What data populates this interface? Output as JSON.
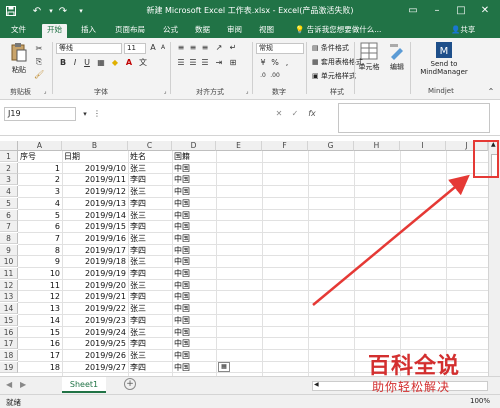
{
  "title": {
    "text": "新建 Microsoft Excel 工作表.xlsx - Excel(产品激活失败)"
  },
  "menu": {
    "file": "文件",
    "home": "开始",
    "insert": "插入",
    "layout": "页面布局",
    "formulas": "公式",
    "data": "数据",
    "review": "审阅",
    "view": "视图",
    "tell_me": "告诉我您想要做什么...",
    "share": "共享"
  },
  "ribbon": {
    "paste": "粘贴",
    "font_name": "等线",
    "font_size": "11",
    "number_format": "常规",
    "conditional_format": "条件格式",
    "table_format": "套用表格格式",
    "cell_style": "单元格样式",
    "cells": "单元格",
    "editing": "编辑",
    "send_to_line1": "Send to",
    "send_to_line2": "MindManager",
    "group_clipboard": "剪贴板",
    "group_font": "字体",
    "group_alignment": "对齐方式",
    "group_number": "数字",
    "group_styles": "样式",
    "group_mindjet": "Mindjet"
  },
  "formula_bar": {
    "name_box": "J19",
    "fx": "fx"
  },
  "grid": {
    "columns": [
      "A",
      "B",
      "C",
      "D",
      "E",
      "F",
      "G",
      "H",
      "I",
      "J"
    ],
    "row_numbers": [
      "1",
      "2",
      "3",
      "4",
      "5",
      "6",
      "7",
      "8",
      "9",
      "10",
      "11",
      "12",
      "13",
      "14",
      "15",
      "16",
      "17",
      "18",
      "19"
    ],
    "header": {
      "a": "序号",
      "b": "日期",
      "c": "姓名",
      "d": "国籍"
    },
    "rows": [
      {
        "a": "1",
        "b": "2019/9/10",
        "c": "张三",
        "d": "中国"
      },
      {
        "a": "2",
        "b": "2019/9/11",
        "c": "李四",
        "d": "中国"
      },
      {
        "a": "3",
        "b": "2019/9/12",
        "c": "张三",
        "d": "中国"
      },
      {
        "a": "4",
        "b": "2019/9/13",
        "c": "李四",
        "d": "中国"
      },
      {
        "a": "5",
        "b": "2019/9/14",
        "c": "张三",
        "d": "中国"
      },
      {
        "a": "6",
        "b": "2019/9/15",
        "c": "李四",
        "d": "中国"
      },
      {
        "a": "7",
        "b": "2019/9/16",
        "c": "张三",
        "d": "中国"
      },
      {
        "a": "8",
        "b": "2019/9/17",
        "c": "李四",
        "d": "中国"
      },
      {
        "a": "9",
        "b": "2019/9/18",
        "c": "张三",
        "d": "中国"
      },
      {
        "a": "10",
        "b": "2019/9/19",
        "c": "李四",
        "d": "中国"
      },
      {
        "a": "11",
        "b": "2019/9/20",
        "c": "张三",
        "d": "中国"
      },
      {
        "a": "12",
        "b": "2019/9/21",
        "c": "李四",
        "d": "中国"
      },
      {
        "a": "13",
        "b": "2019/9/22",
        "c": "张三",
        "d": "中国"
      },
      {
        "a": "14",
        "b": "2019/9/23",
        "c": "李四",
        "d": "中国"
      },
      {
        "a": "15",
        "b": "2019/9/24",
        "c": "张三",
        "d": "中国"
      },
      {
        "a": "16",
        "b": "2019/9/25",
        "c": "李四",
        "d": "中国"
      },
      {
        "a": "17",
        "b": "2019/9/26",
        "c": "张三",
        "d": "中国"
      },
      {
        "a": "18",
        "b": "2019/9/27",
        "c": "李四",
        "d": "中国"
      }
    ]
  },
  "sheets": {
    "active": "Sheet1"
  },
  "status": {
    "ready": "就绪",
    "zoom": "100%"
  },
  "watermark": {
    "line1": "百科全说",
    "line2": "助你轻松解决"
  },
  "colors": {
    "excel_green": "#217346",
    "annotation_red": "#e53935",
    "watermark_red": "#d32f2f"
  }
}
